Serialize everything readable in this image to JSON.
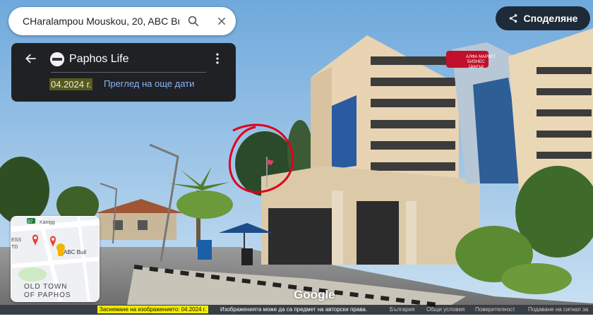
{
  "search": {
    "query": "CHaralampou Mouskou, 20, ABC Bu"
  },
  "share": {
    "label": "Споделяне"
  },
  "info_card": {
    "title": "Paphos Life",
    "date": "04.2024",
    "date_suffix": "г.",
    "more_dates": "Преглед на още дати"
  },
  "street_scene": {
    "building_sign_line1": "АЛФА МАРКЕТ",
    "building_sign_line2": "БИЗНЕС",
    "building_sign_line3": "Център"
  },
  "minimap": {
    "road_badge": "B7",
    "street": "Kanigg",
    "place_label": "ABC Buil",
    "edge_label_1": "ESS",
    "edge_label_2": "TD",
    "district_line1": "OLD TOWN",
    "district_line2": "OF PAPHOS"
  },
  "watermark": "Google",
  "footer": {
    "capture": "Заснемане на изображението: 04.2024 г.",
    "copyright": "Изображенията може да са предмет на авторски права.",
    "country": "България",
    "terms": "Общи условия",
    "privacy": "Поверителност",
    "report": "Подаване на сигнал за"
  },
  "colors": {
    "accent": "#8ab4f8",
    "highlight": "#f2ec00",
    "annotation": "#e0001b"
  }
}
